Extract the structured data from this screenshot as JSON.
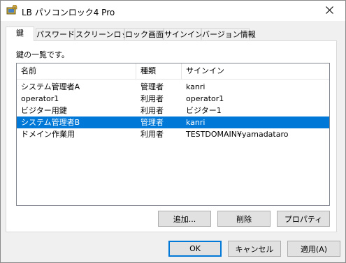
{
  "window": {
    "title": "LB パソコンロック4 Pro"
  },
  "tabs": [
    {
      "label": "鍵",
      "active": true
    },
    {
      "label": "パスワード",
      "active": false
    },
    {
      "label": "スクリーンロック",
      "active": false
    },
    {
      "label": "ロック画面",
      "active": false
    },
    {
      "label": "サインイン",
      "active": false
    },
    {
      "label": "バージョン情報",
      "active": false
    }
  ],
  "panel": {
    "caption": "鍵の一覧です。",
    "columns": [
      "名前",
      "種類",
      "サインイン"
    ],
    "rows": [
      {
        "name": "システム管理者A",
        "type": "管理者",
        "signin": "kanri",
        "selected": false
      },
      {
        "name": "operator1",
        "type": "利用者",
        "signin": "operator1",
        "selected": false
      },
      {
        "name": "ビジター用鍵",
        "type": "利用者",
        "signin": "ビジター1",
        "selected": false
      },
      {
        "name": "システム管理者B",
        "type": "管理者",
        "signin": "kanri",
        "selected": true
      },
      {
        "name": "ドメイン作業用",
        "type": "利用者",
        "signin": "TESTDOMAIN¥yamadataro",
        "selected": false
      }
    ],
    "buttons": {
      "add": "追加...",
      "delete": "削除",
      "properties": "プロパティ"
    }
  },
  "footer": {
    "ok": "OK",
    "cancel": "キャンセル",
    "apply": "適用(A)"
  },
  "colors": {
    "selection": "#0078d7",
    "default_button_border": "#0078d7"
  },
  "icons": {
    "app": "app-lock-icon",
    "close": "close-icon"
  }
}
